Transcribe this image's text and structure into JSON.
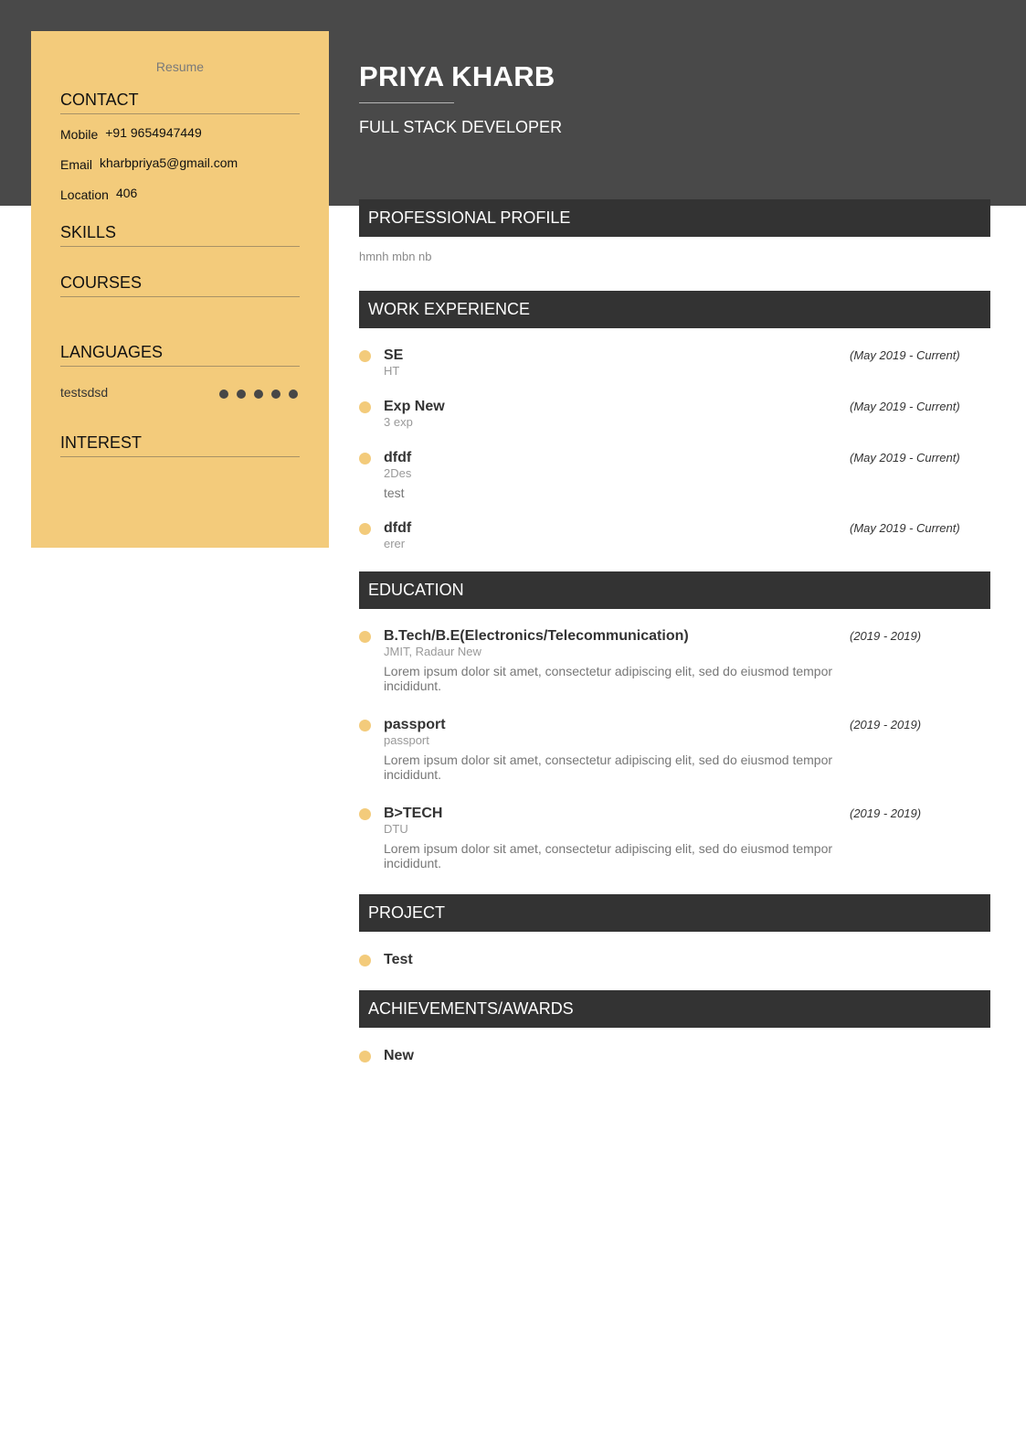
{
  "sidebar": {
    "resume_label": "Resume",
    "contact_heading": "CONTACT",
    "contact": [
      {
        "label": "Mobile",
        "value": "+91 9654947449"
      },
      {
        "label": "Email",
        "value": "kharbpriya5@gmail.com"
      },
      {
        "label": "Location",
        "value": "406"
      }
    ],
    "skills_heading": "SKILLS",
    "courses_heading": "COURSES",
    "languages_heading": "LANGUAGES",
    "languages": [
      {
        "name": "testsdsd",
        "level": 5,
        "max": 5
      }
    ],
    "interest_heading": "INTEREST"
  },
  "header": {
    "name": "PRIYA KHARB",
    "title": "FULL STACK DEVELOPER"
  },
  "profile": {
    "heading": "PROFESSIONAL PROFILE",
    "text": "hmnh mbn nb"
  },
  "work": {
    "heading": "WORK EXPERIENCE",
    "items": [
      {
        "title": "SE",
        "sub": "HT",
        "desc": "",
        "date": "(May 2019 - Current)"
      },
      {
        "title": "Exp New",
        "sub": "3 exp",
        "desc": "",
        "date": "(May 2019 - Current)"
      },
      {
        "title": "dfdf",
        "sub": "2Des",
        "desc": "test",
        "date": "(May 2019 - Current)"
      },
      {
        "title": "dfdf",
        "sub": "erer",
        "desc": "",
        "date": "(May 2019 - Current)"
      }
    ]
  },
  "education": {
    "heading": "EDUCATION",
    "items": [
      {
        "title": "B.Tech/B.E(Electronics/Telecommunication)",
        "sub": "JMIT, Radaur New",
        "desc": "Lorem ipsum dolor sit amet, consectetur adipiscing elit, sed do eiusmod tempor incididunt.",
        "date": "(2019 - 2019)"
      },
      {
        "title": "passport",
        "sub": "passport",
        "desc": "Lorem ipsum dolor sit amet, consectetur adipiscing elit, sed do eiusmod tempor incididunt.",
        "date": "(2019 - 2019)"
      },
      {
        "title": "B>TECH",
        "sub": "DTU",
        "desc": "Lorem ipsum dolor sit amet, consectetur adipiscing elit, sed do eiusmod tempor incididunt.",
        "date": "(2019 - 2019)"
      }
    ]
  },
  "project": {
    "heading": "PROJECT",
    "items": [
      {
        "title": "Test"
      }
    ]
  },
  "awards": {
    "heading": "ACHIEVEMENTS/AWARDS",
    "items": [
      {
        "title": "New"
      }
    ]
  },
  "colors": {
    "header_bg": "#494949",
    "sidebar_bg": "#f3cb7b",
    "section_bar": "#333333",
    "bullet": "#f3cb7b"
  }
}
